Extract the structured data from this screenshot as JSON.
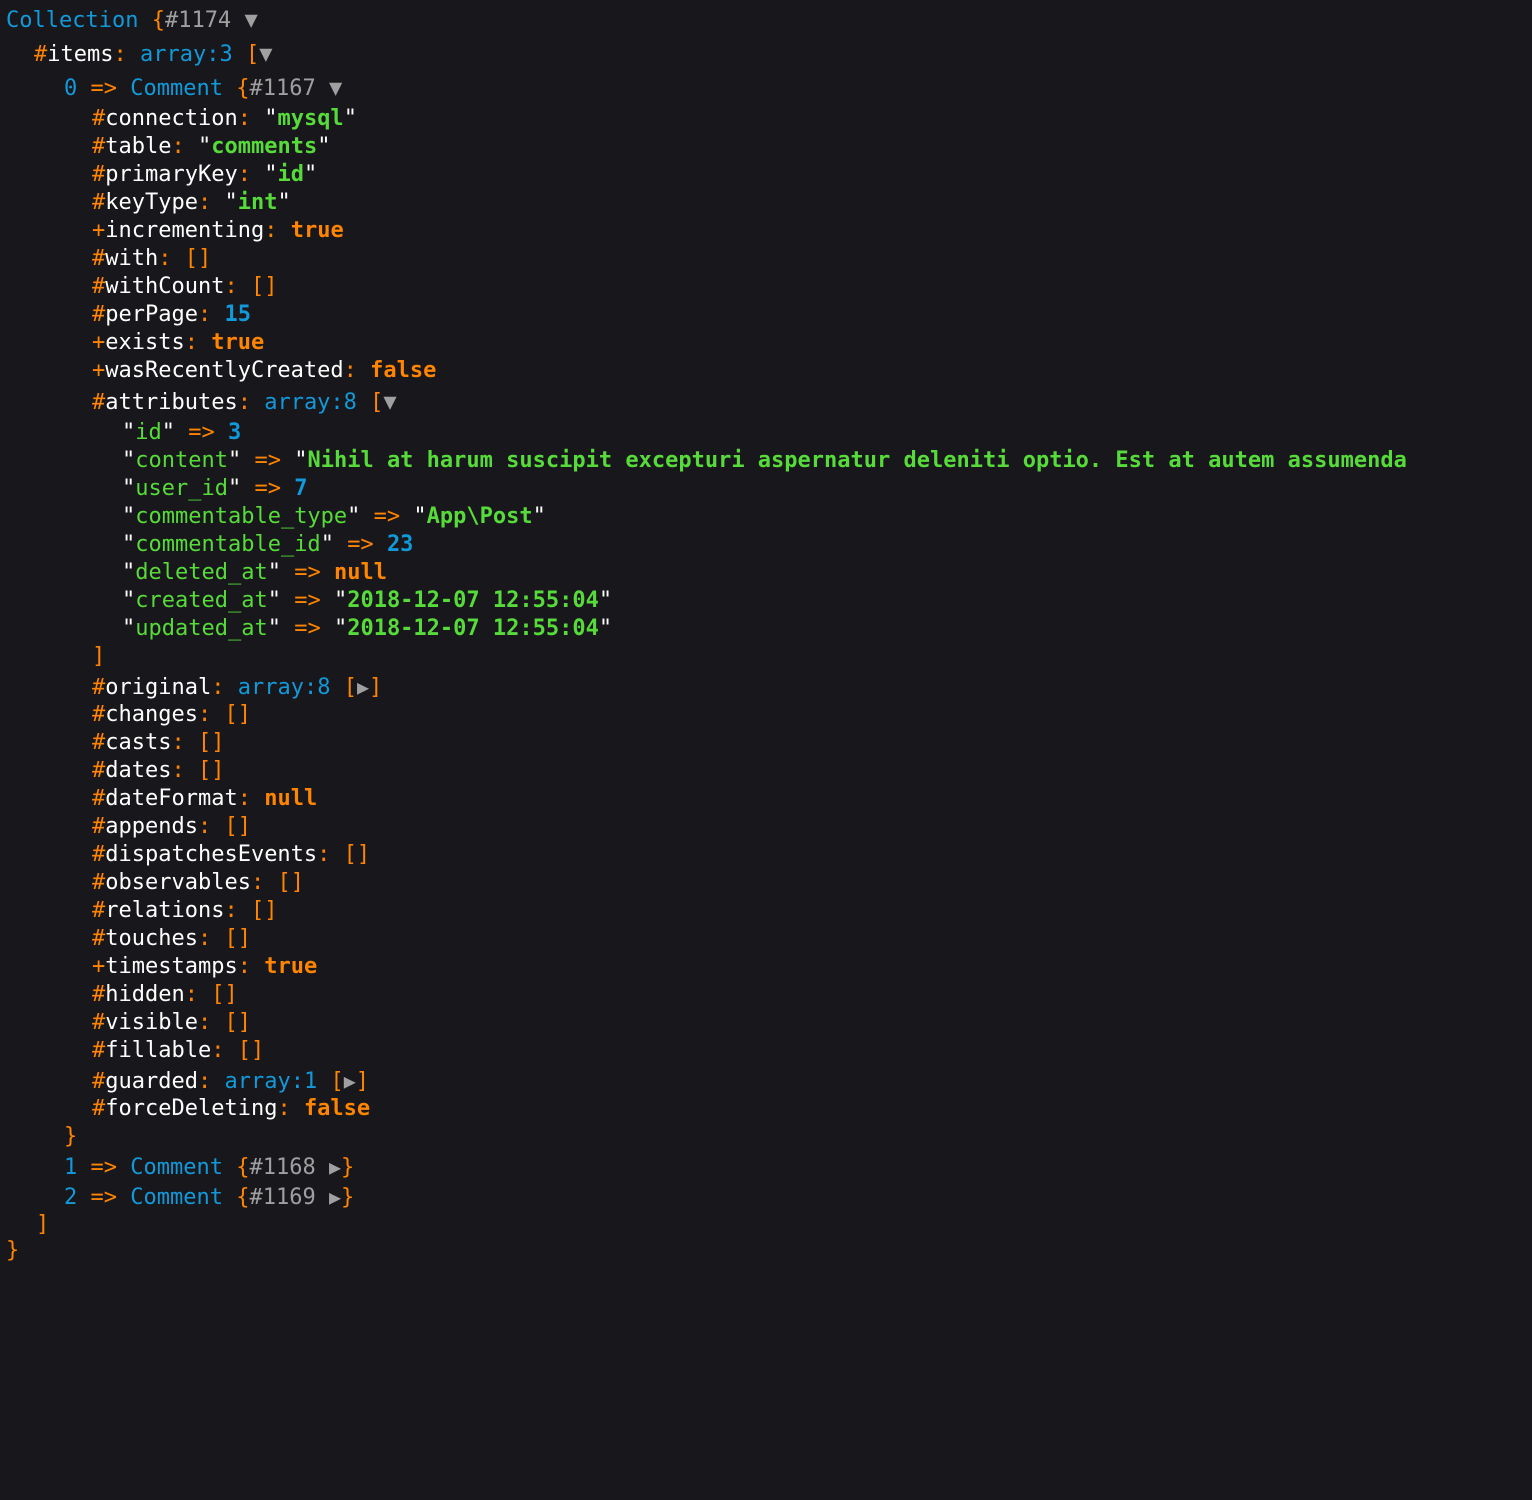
{
  "collection": {
    "class": "Collection",
    "id": "#1174",
    "items_prop": "items",
    "items_note": "array:3"
  },
  "item0": {
    "index": "0",
    "class": "Comment",
    "id": "#1167",
    "connection": "mysql",
    "table": "comments",
    "primaryKey": "id",
    "keyType": "int",
    "incrementing": "true",
    "perPage": "15",
    "exists": "true",
    "wasRecentlyCreated": "false",
    "attributes_note": "array:8",
    "attributes": {
      "id": "3",
      "content": "Nihil at harum suscipit excepturi aspernatur deleniti optio. Est at autem assumenda",
      "user_id": "7",
      "commentable_type": "App\\Post",
      "commentable_id": "23",
      "deleted_at": "null",
      "created_at": "2018-12-07 12:55:04",
      "updated_at": "2018-12-07 12:55:04"
    },
    "original_note": "array:8",
    "dateFormat": "null",
    "timestamps": "true",
    "guarded_note": "array:1",
    "forceDeleting": "false"
  },
  "item1": {
    "index": "1",
    "class": "Comment",
    "id": "#1168"
  },
  "item2": {
    "index": "2",
    "class": "Comment",
    "id": "#1169"
  },
  "labels": {
    "connection": "connection",
    "table": "table",
    "primaryKey": "primaryKey",
    "keyType": "keyType",
    "incrementing": "incrementing",
    "with": "with",
    "withCount": "withCount",
    "perPage": "perPage",
    "exists": "exists",
    "wasRecentlyCreated": "wasRecentlyCreated",
    "attributes": "attributes",
    "original": "original",
    "changes": "changes",
    "casts": "casts",
    "dates": "dates",
    "dateFormat": "dateFormat",
    "appends": "appends",
    "dispatchesEvents": "dispatchesEvents",
    "observables": "observables",
    "relations": "relations",
    "touches": "touches",
    "timestamps": "timestamps",
    "hidden": "hidden",
    "visible": "visible",
    "fillable": "fillable",
    "guarded": "guarded",
    "forceDeleting": "forceDeleting",
    "k_id": "id",
    "k_content": "content",
    "k_user_id": "user_id",
    "k_commentable_type": "commentable_type",
    "k_commentable_id": "commentable_id",
    "k_deleted_at": "deleted_at",
    "k_created_at": "created_at",
    "k_updated_at": "updated_at"
  },
  "symbols": {
    "arrow": "=>",
    "empty_array": "[]",
    "open_brace": "{",
    "close_brace": "}",
    "open_bracket": "[",
    "close_bracket": "]",
    "protected": "#",
    "public": "+"
  }
}
